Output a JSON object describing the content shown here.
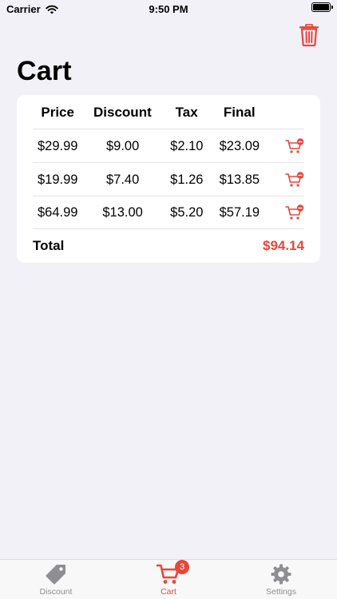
{
  "status_bar": {
    "carrier": "Carrier",
    "time": "9:50 PM"
  },
  "page": {
    "title": "Cart"
  },
  "table": {
    "headers": {
      "price": "Price",
      "discount": "Discount",
      "tax": "Tax",
      "final": "Final"
    },
    "rows": [
      {
        "price": "$29.99",
        "discount": "$9.00",
        "tax": "$2.10",
        "final": "$23.09"
      },
      {
        "price": "$19.99",
        "discount": "$7.40",
        "tax": "$1.26",
        "final": "$13.85"
      },
      {
        "price": "$64.99",
        "discount": "$13.00",
        "tax": "$5.20",
        "final": "$57.19"
      }
    ],
    "total_label": "Total",
    "total_value": "$94.14"
  },
  "tab_bar": {
    "tabs": [
      {
        "label": "Discount",
        "icon": "tag-icon"
      },
      {
        "label": "Cart",
        "icon": "cart-icon",
        "badge": "3"
      },
      {
        "label": "Settings",
        "icon": "gear-icon"
      }
    ]
  },
  "colors": {
    "accent": "#e8463a",
    "inactive": "#8e8e93",
    "background": "#f2f1f7"
  }
}
